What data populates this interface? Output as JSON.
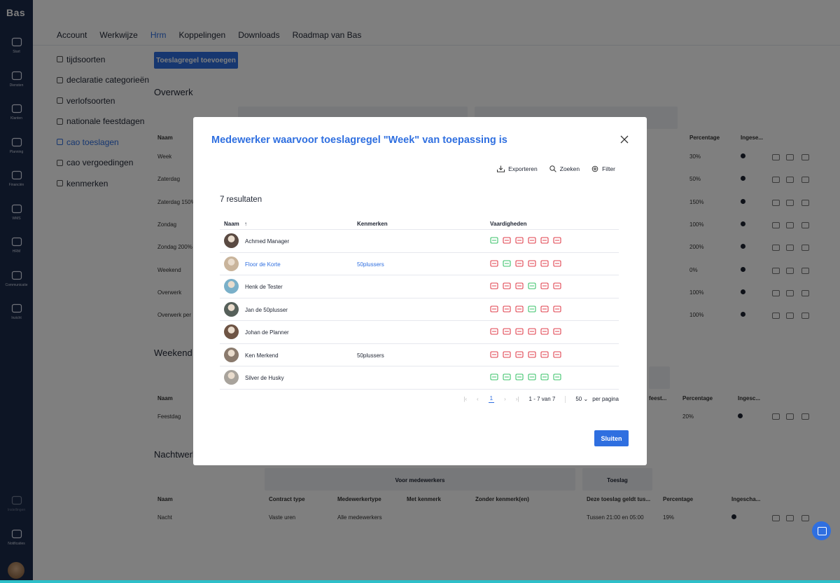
{
  "sidebar": {
    "logo": "Bas",
    "items": [
      {
        "label": "Start",
        "icon": "dashboard-icon"
      },
      {
        "label": "Diensten",
        "icon": "scooter-icon"
      },
      {
        "label": "Klanten",
        "icon": "users-icon"
      },
      {
        "label": "Planning",
        "icon": "calendar-icon"
      },
      {
        "label": "Financiën",
        "icon": "coins-icon"
      },
      {
        "label": "WMS",
        "icon": "warehouse-icon"
      },
      {
        "label": "HRM",
        "icon": "people-icon"
      },
      {
        "label": "Communicatie",
        "icon": "chat-icon"
      },
      {
        "label": "Inzicht",
        "icon": "chart-icon"
      },
      {
        "label": "Instellingen",
        "icon": "gear-icon"
      },
      {
        "label": "Notificaties",
        "icon": "bell-icon"
      }
    ]
  },
  "topnav": [
    "Account",
    "Werkwijze",
    "Hrm",
    "Koppelingen",
    "Downloads",
    "Roadmap van Bas"
  ],
  "subnav": [
    "tijdsoorten",
    "declaratie categorieën",
    "verlofsoorten",
    "nationale feestdagen",
    "cao toeslagen",
    "cao vergoedingen",
    "kenmerken"
  ],
  "background": {
    "add_button": "Toeslagregel toevoegen",
    "overwerk": {
      "title": "Overwerk",
      "headers": {
        "naam": "Naam",
        "percentage": "Percentage",
        "ingesteld": "Ingese..."
      },
      "rows": [
        {
          "naam": "Week",
          "pct": "30%"
        },
        {
          "naam": "Zaterdag",
          "pct": "50%"
        },
        {
          "naam": "Zaterdag 150%",
          "pct": "150%"
        },
        {
          "naam": "Zondag",
          "pct": "100%"
        },
        {
          "naam": "Zondag 200%",
          "pct": "200%"
        },
        {
          "naam": "Weekend",
          "pct": "0%"
        },
        {
          "naam": "Overwerk",
          "pct": "100%"
        },
        {
          "naam": "Overwerk per",
          "pct": "100%"
        }
      ]
    },
    "weekend": {
      "title": "Weekend e",
      "headers": {
        "naam": "Naam",
        "feest": "feest...",
        "percentage": "Percentage",
        "ingesteld": "Ingesc..."
      },
      "row": {
        "naam": "Feestdag",
        "pct": "20%"
      }
    },
    "nacht": {
      "title": "Nachtwerk",
      "band1": "Voor medewerkers",
      "band2": "Toeslag",
      "headers": {
        "naam": "Naam",
        "contract": "Contract type",
        "medewerkertype": "Medewerkertype",
        "met": "Met kenmerk",
        "zonder": "Zonder kenmerk(en)",
        "geldt": "Deze toeslag geldt tus...",
        "percentage": "Percentage",
        "ingesteld": "Ingescha..."
      },
      "row": {
        "naam": "Nacht",
        "contract": "Vaste uren",
        "medewerkertype": "Alle medewerkers",
        "geldt": "Tussen 21:00 en 05:00",
        "pct": "19%"
      }
    }
  },
  "modal": {
    "title": "Medewerker waarvoor toeslagregel \"Week\" van toepassing is",
    "toolbar": {
      "export": "Exporteren",
      "search": "Zoeken",
      "filter": "Filter"
    },
    "results": "7 resultaten",
    "headers": {
      "naam": "Naam",
      "kenmerken": "Kenmerken",
      "vaardigheden": "Vaardigheden"
    },
    "rows": [
      {
        "name": "Achmed Manager",
        "kenmerk": "",
        "link": false,
        "avatar": "#5a4a42",
        "skills": [
          "green",
          "red",
          "red",
          "red",
          "red",
          "red"
        ]
      },
      {
        "name": "Floor de Korte",
        "kenmerk": "50plussers",
        "link": true,
        "avatar": "#c9b49b",
        "skills": [
          "red",
          "green",
          "red",
          "red",
          "red",
          "red"
        ]
      },
      {
        "name": "Henk de Tester",
        "kenmerk": "",
        "link": false,
        "avatar": "#7ab0c9",
        "skills": [
          "red",
          "red",
          "red",
          "green",
          "red",
          "red"
        ]
      },
      {
        "name": "Jan de 50plusser",
        "kenmerk": "",
        "link": false,
        "avatar": "#56605a",
        "skills": [
          "red",
          "red",
          "red",
          "green",
          "red",
          "red"
        ]
      },
      {
        "name": "Johan de Planner",
        "kenmerk": "",
        "link": false,
        "avatar": "#6e5444",
        "skills": [
          "red",
          "red",
          "red",
          "red",
          "red",
          "red"
        ]
      },
      {
        "name": "Ken Merkend",
        "kenmerk": "50plussers",
        "link": false,
        "avatar": "#8a7a6d",
        "skills": [
          "red",
          "red",
          "red",
          "red",
          "red",
          "red"
        ]
      },
      {
        "name": "Silver de Husky",
        "kenmerk": "",
        "link": false,
        "avatar": "#a8a39c",
        "skills": [
          "green",
          "green",
          "green",
          "green",
          "green",
          "green"
        ]
      }
    ],
    "pager": {
      "page": "1",
      "range": "1 - 7 van 7",
      "per_page": "50",
      "per_page_label": "per pagina"
    },
    "close_button": "Sluiten"
  },
  "colors": {
    "accent": "#2f6fe0",
    "sidebar": "#1b2a4a",
    "skill_red": "#e0424e",
    "skill_green": "#3cc36b"
  }
}
